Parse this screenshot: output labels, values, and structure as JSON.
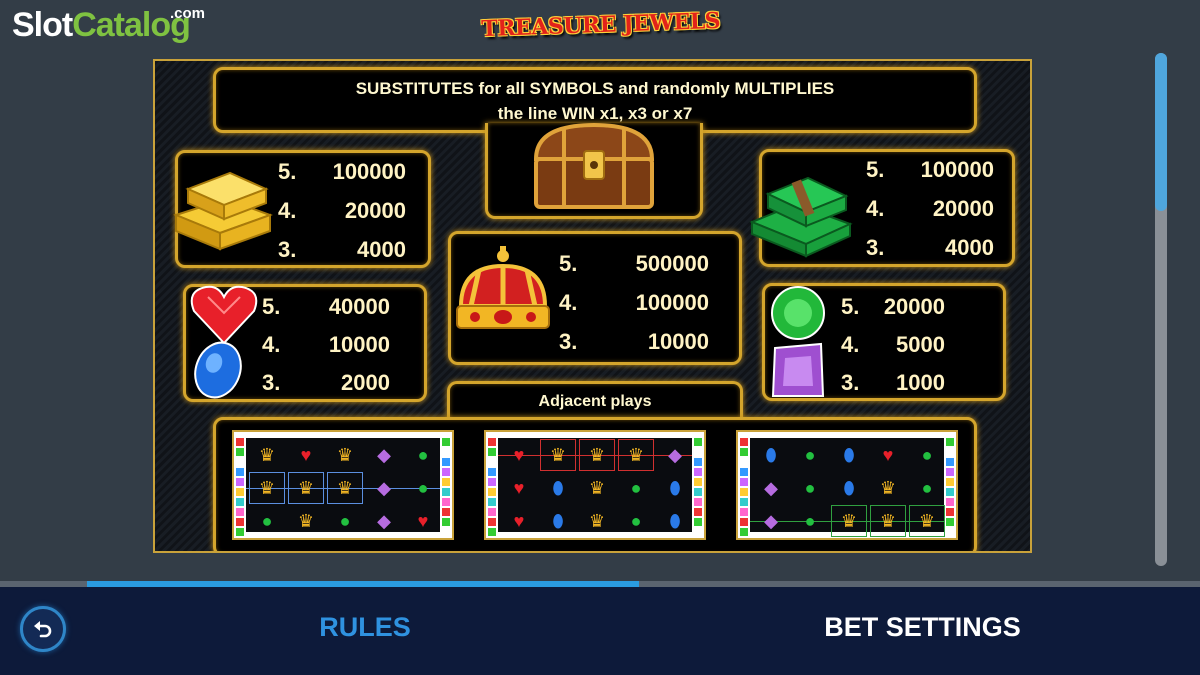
{
  "watermark": {
    "part1": "Slot",
    "part2": "Catalog",
    "suffix": ".com"
  },
  "game_title": "TREASURE JEWELS",
  "wild": {
    "description_line1": "SUBSTITUTES for all SYMBOLS and randomly MULTIPLIES",
    "description_line2": "the line WIN x1, x3 or x7",
    "icon": "treasure-chest"
  },
  "paytable": [
    {
      "id": "gold",
      "icon": "gold-bars",
      "rows": [
        {
          "count": "5.",
          "value": "100000"
        },
        {
          "count": "4.",
          "value": "20000"
        },
        {
          "count": "3.",
          "value": "4000"
        }
      ]
    },
    {
      "id": "cash",
      "icon": "money-stacks",
      "rows": [
        {
          "count": "5.",
          "value": "100000"
        },
        {
          "count": "4.",
          "value": "20000"
        },
        {
          "count": "3.",
          "value": "4000"
        }
      ]
    },
    {
      "id": "crown",
      "icon": "crown",
      "rows": [
        {
          "count": "5.",
          "value": "500000"
        },
        {
          "count": "4.",
          "value": "100000"
        },
        {
          "count": "3.",
          "value": "10000"
        }
      ]
    },
    {
      "id": "heart-sapphire",
      "icon": "red-heart-blue-gem",
      "rows": [
        {
          "count": "5.",
          "value": "40000"
        },
        {
          "count": "4.",
          "value": "10000"
        },
        {
          "count": "3.",
          "value": "2000"
        }
      ]
    },
    {
      "id": "emerald-amethyst",
      "icon": "green-purple-gem",
      "rows": [
        {
          "count": "5.",
          "value": "20000"
        },
        {
          "count": "4.",
          "value": "5000"
        },
        {
          "count": "3.",
          "value": "1000"
        }
      ]
    }
  ],
  "adjacent_title": "Adjacent plays",
  "examples": [
    {
      "rows": [
        [
          "crown",
          "heart",
          "crown",
          "amethyst",
          "emerald"
        ],
        [
          "crown",
          "crown",
          "crown",
          "amethyst",
          "emerald"
        ],
        [
          "emerald",
          "crown",
          "emerald",
          "amethyst",
          "heart"
        ]
      ],
      "highlight_row": 1,
      "highlight_cols": [
        0,
        1,
        2
      ],
      "color": "blue"
    },
    {
      "rows": [
        [
          "heart",
          "crown",
          "crown",
          "crown",
          "amethyst"
        ],
        [
          "heart",
          "sapphire",
          "crown",
          "emerald",
          "sapphire"
        ],
        [
          "heart",
          "sapphire",
          "crown",
          "emerald",
          "sapphire"
        ]
      ],
      "highlight_row": 0,
      "highlight_cols": [
        1,
        2,
        3
      ],
      "color": "red"
    },
    {
      "rows": [
        [
          "sapphire",
          "emerald",
          "sapphire",
          "heart",
          "emerald"
        ],
        [
          "amethyst",
          "emerald",
          "sapphire",
          "crown",
          "emerald"
        ],
        [
          "amethyst",
          "emerald",
          "crown",
          "crown",
          "crown"
        ]
      ],
      "highlight_row": 2,
      "highlight_cols": [
        2,
        3,
        4
      ],
      "color": "green"
    }
  ],
  "scroll_position": 0,
  "progress_fraction": 0.46,
  "nav": {
    "rules_label": "RULES",
    "bet_label": "BET SETTINGS",
    "back_icon": "undo-arrow-icon"
  },
  "colors": {
    "accent": "#2f92e0",
    "gold": "#d4a52c",
    "bar_bg": "#0d1a3a"
  }
}
